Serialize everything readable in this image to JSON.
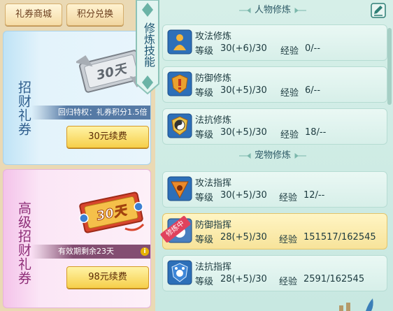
{
  "tabs": [
    {
      "label": "礼券商城"
    },
    {
      "label": "积分兑换"
    }
  ],
  "cards": [
    {
      "title": "招财礼券",
      "ticket_text": "30天",
      "info": "回归特权：礼券积分1.5倍",
      "button": "30元续费"
    },
    {
      "title": "高级招财礼券",
      "ticket_text": "30天",
      "info": "有效期剩余23天",
      "button": "98元续费"
    }
  ],
  "ribbon": "修炼技能",
  "sections": {
    "character": "人物修炼",
    "pet": "宠物修炼"
  },
  "labels": {
    "level": "等级",
    "exp": "经验"
  },
  "active_badge": "修炼中",
  "character_skills": [
    {
      "name": "攻法修炼",
      "level": "30(+6)/30",
      "exp": "0/--",
      "icon": "attack-cultivation-icon"
    },
    {
      "name": "防御修炼",
      "level": "30(+5)/30",
      "exp": "6/--",
      "icon": "defense-cultivation-icon"
    },
    {
      "name": "法抗修炼",
      "level": "30(+5)/30",
      "exp": "18/--",
      "icon": "magic-resist-cultivation-icon"
    }
  ],
  "pet_skills": [
    {
      "name": "攻法指挥",
      "level": "30(+5)/30",
      "exp": "12/--",
      "icon": "attack-command-icon",
      "active": false
    },
    {
      "name": "防御指挥",
      "level": "28(+5)/30",
      "exp": "151517/162545",
      "icon": "defense-command-icon",
      "active": true
    },
    {
      "name": "法抗指挥",
      "level": "28(+5)/30",
      "exp": "2591/162545",
      "icon": "magic-resist-command-icon",
      "active": false
    }
  ],
  "colors": {
    "active_row": "#f7e39a",
    "badge": "#e0425d",
    "panel": "#d6efe8"
  }
}
